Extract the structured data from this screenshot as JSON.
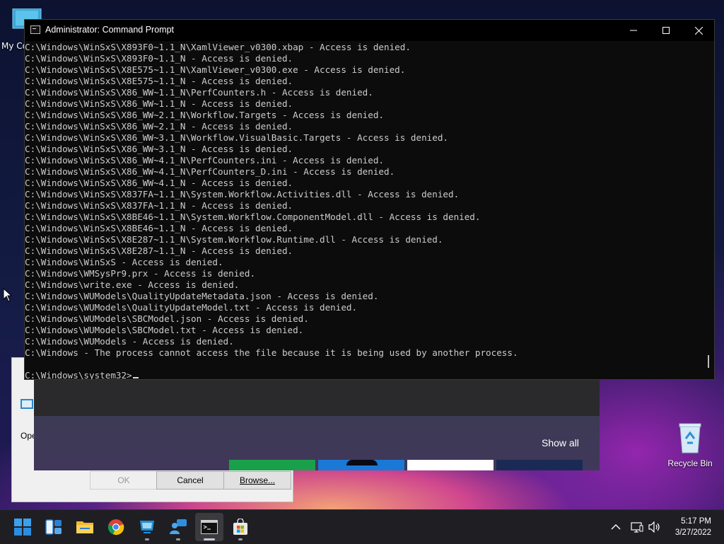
{
  "desktop": {
    "icons": [
      {
        "label": "My Co",
        "icon": "computer-icon"
      },
      {
        "label": "Recycle Bin",
        "icon": "recycle-bin-icon"
      }
    ]
  },
  "run_dialog": {
    "open_label_fragment": "Ope",
    "ok_label": "OK",
    "cancel_label": "Cancel",
    "browse_label": "Browse..."
  },
  "start_panel": {
    "show_all_label": "Show all"
  },
  "cmd_window": {
    "title": "Administrator: Command Prompt",
    "lines": [
      "C:\\Windows\\WinSxS\\X893F0~1.1_N\\XamlViewer_v0300.xbap - Access is denied.",
      "C:\\Windows\\WinSxS\\X893F0~1.1_N - Access is denied.",
      "C:\\Windows\\WinSxS\\X8E575~1.1_N\\XamlViewer_v0300.exe - Access is denied.",
      "C:\\Windows\\WinSxS\\X8E575~1.1_N - Access is denied.",
      "C:\\Windows\\WinSxS\\X86_WW~1.1_N\\PerfCounters.h - Access is denied.",
      "C:\\Windows\\WinSxS\\X86_WW~1.1_N - Access is denied.",
      "C:\\Windows\\WinSxS\\X86_WW~2.1_N\\Workflow.Targets - Access is denied.",
      "C:\\Windows\\WinSxS\\X86_WW~2.1_N - Access is denied.",
      "C:\\Windows\\WinSxS\\X86_WW~3.1_N\\Workflow.VisualBasic.Targets - Access is denied.",
      "C:\\Windows\\WinSxS\\X86_WW~3.1_N - Access is denied.",
      "C:\\Windows\\WinSxS\\X86_WW~4.1_N\\PerfCounters.ini - Access is denied.",
      "C:\\Windows\\WinSxS\\X86_WW~4.1_N\\PerfCounters_D.ini - Access is denied.",
      "C:\\Windows\\WinSxS\\X86_WW~4.1_N - Access is denied.",
      "C:\\Windows\\WinSxS\\X837FA~1.1_N\\System.Workflow.Activities.dll - Access is denied.",
      "C:\\Windows\\WinSxS\\X837FA~1.1_N - Access is denied.",
      "C:\\Windows\\WinSxS\\X8BE46~1.1_N\\System.Workflow.ComponentModel.dll - Access is denied.",
      "C:\\Windows\\WinSxS\\X8BE46~1.1_N - Access is denied.",
      "C:\\Windows\\WinSxS\\X8E287~1.1_N\\System.Workflow.Runtime.dll - Access is denied.",
      "C:\\Windows\\WinSxS\\X8E287~1.1_N - Access is denied.",
      "C:\\Windows\\WinSxS - Access is denied.",
      "C:\\Windows\\WMSysPr9.prx - Access is denied.",
      "C:\\Windows\\write.exe - Access is denied.",
      "C:\\Windows\\WUModels\\QualityUpdateMetadata.json - Access is denied.",
      "C:\\Windows\\WUModels\\QualityUpdateModel.txt - Access is denied.",
      "C:\\Windows\\WUModels\\SBCModel.json - Access is denied.",
      "C:\\Windows\\WUModels\\SBCModel.txt - Access is denied.",
      "C:\\Windows\\WUModels - Access is denied.",
      "C:\\Windows - The process cannot access the file because it is being used by another process."
    ],
    "prompt": "C:\\Windows\\system32>"
  },
  "taskbar": {
    "items": [
      {
        "name": "start-button",
        "icon": "windows-logo-icon",
        "active": false
      },
      {
        "name": "widgets-button",
        "icon": "widgets-icon",
        "active": false
      },
      {
        "name": "file-explorer-button",
        "icon": "folder-icon",
        "active": false
      },
      {
        "name": "chrome-button",
        "icon": "chrome-icon",
        "active": false
      },
      {
        "name": "remote-app-button",
        "icon": "monitor-icon",
        "active": false
      },
      {
        "name": "people-app-button",
        "icon": "people-icon",
        "active": false
      },
      {
        "name": "command-prompt-button",
        "icon": "terminal-icon",
        "active": true
      },
      {
        "name": "store-button",
        "icon": "store-bag-icon",
        "active": false
      }
    ],
    "tray": {
      "icons": [
        "chevron-up-icon",
        "network-icon",
        "volume-icon"
      ],
      "time": "5:17 PM",
      "date": "3/27/2022"
    }
  },
  "colors": {
    "console_bg": "#0c0c0c",
    "console_text": "#cccccc",
    "taskbar_bg": "#1f1f23"
  }
}
